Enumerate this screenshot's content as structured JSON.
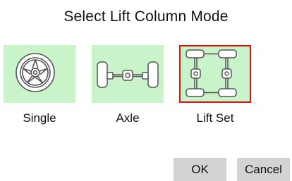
{
  "dialog": {
    "title": "Select Lift Column Mode"
  },
  "modes": [
    {
      "id": "single",
      "label": "Single",
      "icon": "wheel-icon",
      "selected": false
    },
    {
      "id": "axle",
      "label": "Axle",
      "icon": "axle-icon",
      "selected": false
    },
    {
      "id": "liftset",
      "label": "Lift Set",
      "icon": "lift-set-icon",
      "selected": true
    }
  ],
  "buttons": {
    "ok": "OK",
    "cancel": "Cancel"
  },
  "colors": {
    "tile_background": "#c9f3c9",
    "selected_border": "#e01010",
    "button_background": "#d3d3d3"
  }
}
